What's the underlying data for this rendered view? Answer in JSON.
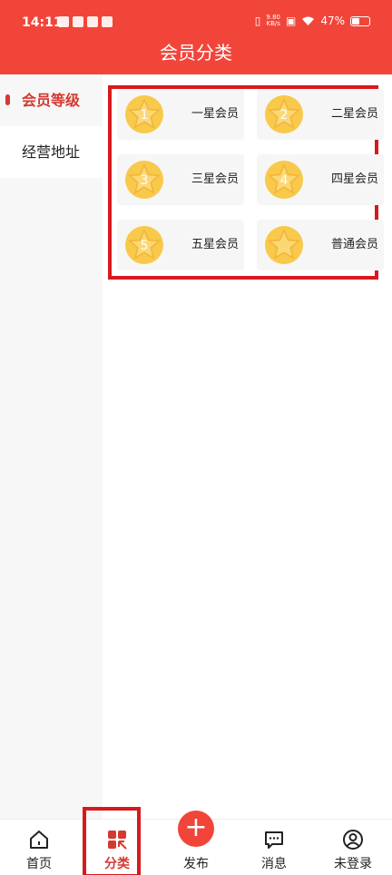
{
  "status_bar": {
    "time": "14:11",
    "network_speed": "9.80",
    "network_unit": "KB/s",
    "battery": "47%",
    "battery_level": 0.47
  },
  "header": {
    "title": "会员分类"
  },
  "sidebar": {
    "items": [
      {
        "label": "会员等级",
        "active": true
      },
      {
        "label": "经营地址",
        "active": false
      }
    ]
  },
  "levels": [
    {
      "number": "1",
      "label": "一星会员"
    },
    {
      "number": "2",
      "label": "二星会员"
    },
    {
      "number": "3",
      "label": "三星会员"
    },
    {
      "number": "4",
      "label": "四星会员"
    },
    {
      "number": "5",
      "label": "五星会员"
    },
    {
      "number": "",
      "label": "普通会员"
    }
  ],
  "tabbar": {
    "items": [
      {
        "label": "首页",
        "icon": "home-icon"
      },
      {
        "label": "分类",
        "icon": "category-icon",
        "active": true
      },
      {
        "label": "发布",
        "icon": "plus-icon"
      },
      {
        "label": "消息",
        "icon": "message-icon"
      },
      {
        "label": "未登录",
        "icon": "user-icon"
      }
    ]
  },
  "colors": {
    "brand": "#f2453a",
    "accent": "#d33a30",
    "star": "#f8c94a"
  }
}
